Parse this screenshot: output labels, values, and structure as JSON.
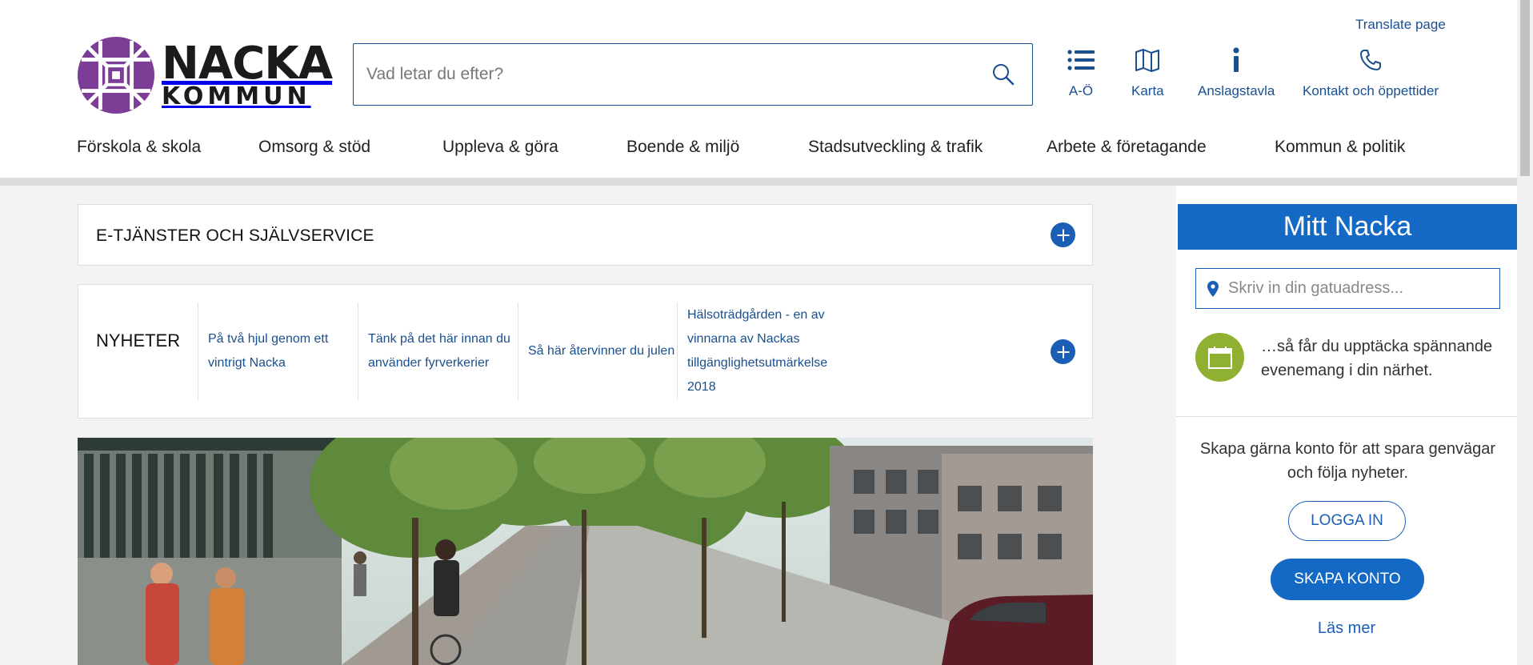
{
  "header": {
    "translate_label": "Translate page",
    "logo": {
      "name": "NACKA",
      "sub": "KOMMUN"
    },
    "search": {
      "placeholder": "Vad letar du efter?",
      "value": ""
    },
    "quick_links": [
      {
        "label": "A-Ö",
        "icon": "list-icon"
      },
      {
        "label": "Karta",
        "icon": "map-icon"
      },
      {
        "label": "Anslagstavla",
        "icon": "info-icon"
      },
      {
        "label": "Kontakt och öppettider",
        "icon": "phone-icon"
      }
    ]
  },
  "nav": {
    "items": [
      "Förskola & skola",
      "Omsorg & stöd",
      "Uppleva & göra",
      "Boende & miljö",
      "Stadsutveckling & trafik",
      "Arbete & företagande",
      "Kommun & politik"
    ]
  },
  "eservices": {
    "title": "E-TJÄNSTER OCH SJÄLVSERVICE"
  },
  "news": {
    "title": "NYHETER",
    "items": [
      "På två hjul genom ett vintrigt Nacka",
      "Tänk på det här innan du använder fyrverkerier",
      "Så här återvinner du julen",
      "Hälsoträdgården - en av vinnarna av Nackas tillgänglighetsutmärkelse 2018"
    ]
  },
  "sidebar": {
    "title": "Mitt Nacka",
    "address_placeholder": "Skriv in din gatuadress...",
    "teaser": "…så får du upptäcka spännande evenemang i din närhet.",
    "account_text": "Skapa gärna konto för att spara genvägar och följa nyheter.",
    "login_label": "LOGGA IN",
    "create_label": "SKAPA KONTO",
    "more_label": "Läs mer"
  },
  "colors": {
    "brand_blue": "#1469c4",
    "link_blue": "#1a4f8f",
    "logo_purple": "#7c3d97",
    "calendar_green": "#8fb030"
  }
}
